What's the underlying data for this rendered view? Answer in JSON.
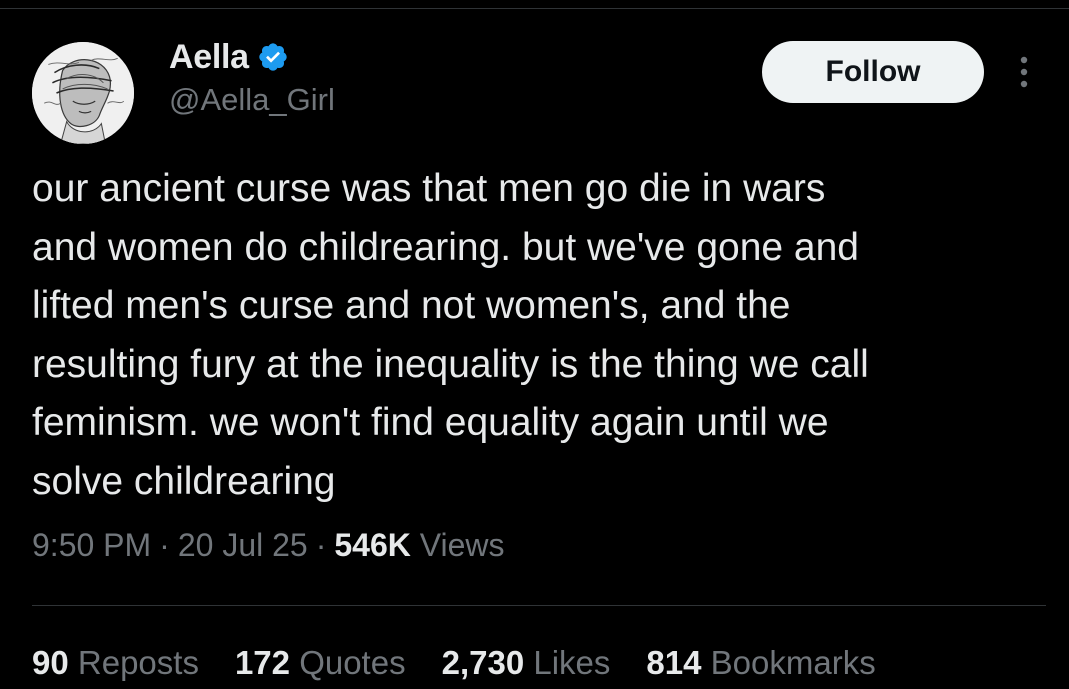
{
  "author": {
    "display_name": "Aella",
    "handle": "@Aella_Girl",
    "verified": true,
    "verified_color": "#1d9bf0",
    "avatar": "sketch-portrait-avatar"
  },
  "follow_button": {
    "label": "Follow"
  },
  "more_options_icon": "vertical-ellipsis-icon",
  "tweet": {
    "text": "our ancient curse was that men go die in wars\nand women do childrearing. but we've gone and\nlifted men's curse and not women's, and the\nresulting fury at the inequality is the thing we call\nfeminism. we won't find equality again until we\nsolve childrearing"
  },
  "meta": {
    "time": "9:50 PM",
    "separator": "·",
    "date": "20 Jul 25",
    "views_count": "546K",
    "views_label": "Views"
  },
  "stats": [
    {
      "count": "90",
      "label": "Reposts"
    },
    {
      "count": "172",
      "label": "Quotes"
    },
    {
      "count": "2,730",
      "label": "Likes"
    },
    {
      "count": "814",
      "label": "Bookmarks"
    }
  ],
  "colors": {
    "background": "#000000",
    "primary_text": "#e7e9ea",
    "secondary_text": "#71767b",
    "divider": "#2f3336",
    "follow_bg": "#eff3f4"
  }
}
